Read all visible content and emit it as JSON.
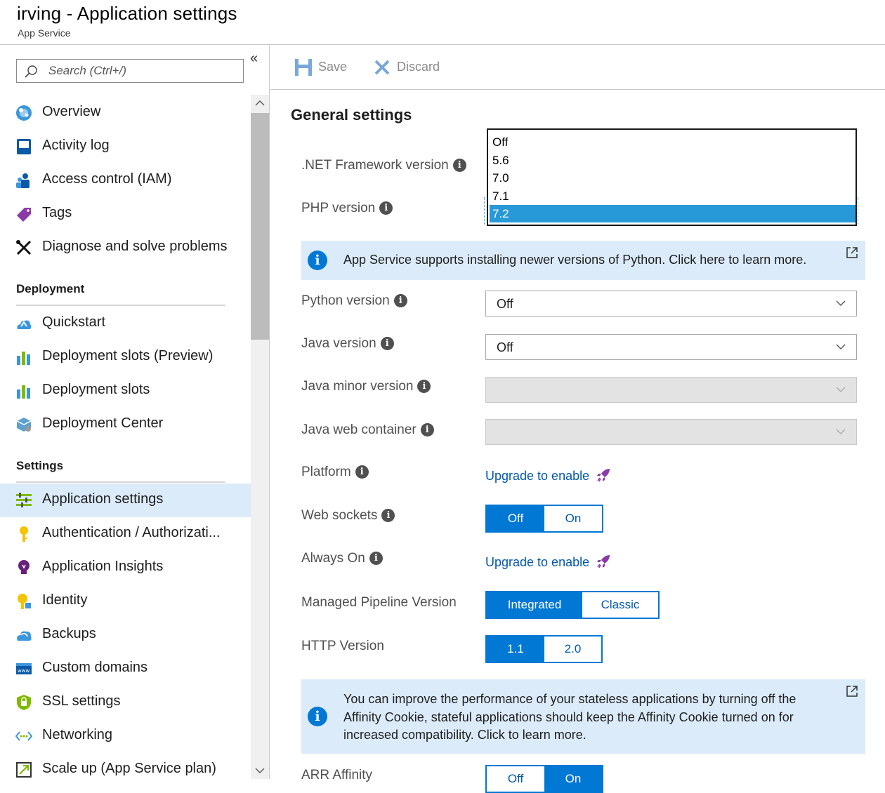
{
  "header": {
    "title": "irving - Application settings",
    "subtitle": "App Service"
  },
  "sidebar": {
    "search_placeholder": "Search (Ctrl+/)",
    "collapse_glyph": "«",
    "top_items": [
      {
        "label": "Overview"
      },
      {
        "label": "Activity log"
      },
      {
        "label": "Access control (IAM)"
      },
      {
        "label": "Tags"
      },
      {
        "label": "Diagnose and solve problems"
      }
    ],
    "sections": [
      {
        "title": "Deployment",
        "items": [
          {
            "label": "Quickstart"
          },
          {
            "label": "Deployment slots (Preview)"
          },
          {
            "label": "Deployment slots"
          },
          {
            "label": "Deployment Center"
          }
        ]
      },
      {
        "title": "Settings",
        "items": [
          {
            "label": "Application settings",
            "active": true
          },
          {
            "label": "Authentication / Authorizati..."
          },
          {
            "label": "Application Insights"
          },
          {
            "label": "Identity"
          },
          {
            "label": "Backups"
          },
          {
            "label": "Custom domains"
          },
          {
            "label": "SSL settings"
          },
          {
            "label": "Networking"
          },
          {
            "label": "Scale up (App Service plan)"
          }
        ]
      }
    ]
  },
  "toolbar": {
    "save_label": "Save",
    "discard_label": "Discard"
  },
  "main": {
    "section_title": "General settings",
    "net_label": ".NET Framework version",
    "php_label": "PHP version",
    "php_options": [
      "Off",
      "5.6",
      "7.0",
      "7.1",
      "7.2"
    ],
    "php_selected": "7.2",
    "python_banner": "App Service supports installing newer versions of Python. Click here to learn more.",
    "python_label": "Python version",
    "python_value": "Off",
    "java_label": "Java version",
    "java_value": "Off",
    "java_minor_label": "Java minor version",
    "java_minor_value": "",
    "java_container_label": "Java web container",
    "java_container_value": "",
    "platform_label": "Platform",
    "platform_link": "Upgrade to enable",
    "websockets_label": "Web sockets",
    "websockets_options": [
      "Off",
      "On"
    ],
    "websockets_selected": "Off",
    "alwayson_label": "Always On",
    "alwayson_link": "Upgrade to enable",
    "pipeline_label": "Managed Pipeline Version",
    "pipeline_options": [
      "Integrated",
      "Classic"
    ],
    "pipeline_selected": "Integrated",
    "http_label": "HTTP Version",
    "http_options": [
      "1.1",
      "2.0"
    ],
    "http_selected": "1.1",
    "affinity_banner_lines": [
      "You can improve the performance of your stateless applications by turning off the",
      "Affinity Cookie, stateful applications should keep the Affinity Cookie turned on for",
      "increased compatibility. Click to learn more."
    ],
    "arr_label": "ARR Affinity",
    "arr_options": [
      "Off",
      "On"
    ],
    "arr_selected": "On"
  },
  "colors": {
    "accent": "#0078d4",
    "link": "#0058ad",
    "active_nav": "#dcebfa",
    "banner_bg": "#dcebfa",
    "dropdown_highlight": "#2899d8",
    "rocket": "#8a3ba6"
  },
  "icons": [
    "search-icon",
    "collapse-icon",
    "overview-icon",
    "activity-log-icon",
    "access-control-icon",
    "tag-icon",
    "wrench-icon",
    "quickstart-cloud-icon",
    "slots-icon",
    "deployment-center-icon",
    "app-settings-icon",
    "key-icon",
    "lightbulb-icon",
    "identity-key-icon",
    "backup-cloud-icon",
    "www-icon",
    "shield-icon",
    "networking-icon",
    "scale-up-icon",
    "save-icon",
    "discard-icon",
    "info-icon",
    "external-link-icon",
    "rocket-icon",
    "chevron-down-icon"
  ]
}
